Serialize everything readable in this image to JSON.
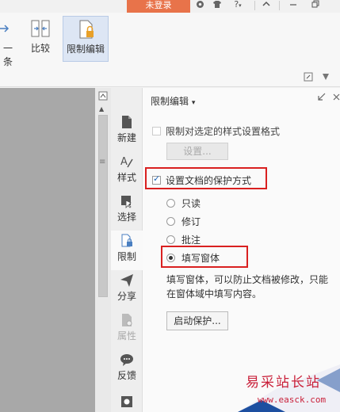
{
  "titlebar": {
    "login_label": "未登录",
    "icons": [
      "skin-icon",
      "shirt-icon",
      "help-icon",
      "collapse-icon",
      "minimize-icon",
      "restore-icon"
    ],
    "help_label": "?"
  },
  "ribbon": {
    "prev_item_label": "一条",
    "compare_label": "比较",
    "restrict_edit_label": "限制编辑"
  },
  "sidebar": {
    "items": [
      {
        "label": "新建",
        "icon": "new-icon"
      },
      {
        "label": "样式",
        "icon": "style-icon"
      },
      {
        "label": "选择",
        "icon": "select-icon"
      },
      {
        "label": "限制",
        "icon": "restrict-icon"
      },
      {
        "label": "分享",
        "icon": "share-icon"
      },
      {
        "label": "属性",
        "icon": "properties-icon"
      },
      {
        "label": "反馈",
        "icon": "feedback-icon"
      }
    ]
  },
  "panel": {
    "title": "限制编辑",
    "title_arrow": "▾",
    "restrict_format_label": "限制对选定的样式设置格式",
    "settings_button": "设置...",
    "protect_label": "设置文档的保护方式",
    "options": [
      "只读",
      "修订",
      "批注",
      "填写窗体"
    ],
    "selected_option": "填写窗体",
    "description": "填写窗体，可以防止文档被修改，只能在窗体域中填写内容。",
    "start_button": "启动保护..."
  },
  "watermark": {
    "title": "易采站长站",
    "url": "www.easck.com"
  },
  "colors": {
    "accent": "#e8734a",
    "highlight": "#d92020",
    "watermark": "#c9203a"
  }
}
